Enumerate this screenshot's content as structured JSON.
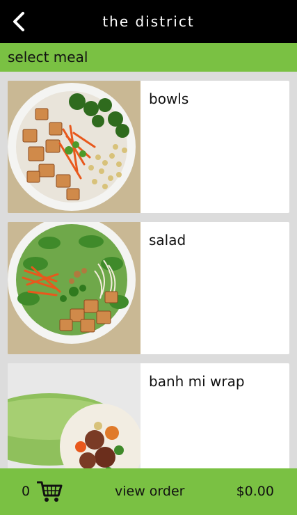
{
  "header": {
    "title": "the district",
    "back_icon": "chevron-left-icon"
  },
  "section": {
    "title": "select meal"
  },
  "menu": {
    "items": [
      {
        "label": "bowls",
        "image": "bowl-dish-image"
      },
      {
        "label": "salad",
        "image": "salad-dish-image"
      },
      {
        "label": "banh mi wrap",
        "image": "wrap-dish-image"
      }
    ]
  },
  "order_bar": {
    "count": "0",
    "cart_icon": "shopping-cart-icon",
    "view_order_label": "view order",
    "total": "$0.00"
  },
  "colors": {
    "accent": "#7ac143",
    "header_bg": "#000000",
    "list_bg": "#dcdcdc"
  }
}
